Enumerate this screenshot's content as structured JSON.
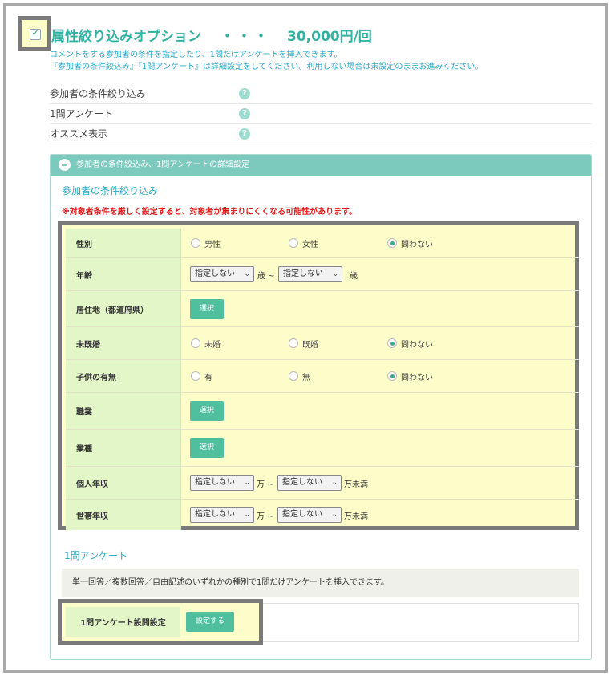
{
  "header": {
    "checkbox_checked": true,
    "title": "属性絞り込みオプション",
    "separator": "・・・",
    "price": "30,000円/回",
    "description_line1": "コメントをする参加者の条件を指定したり、1問だけアンケートを挿入できます。",
    "description_line2": "『参加者の条件絞込み』『1問アンケート』は詳細設定をしてください。利用しない場合は未設定のままお進みください。"
  },
  "options": [
    {
      "label": "参加者の条件絞り込み",
      "icon": "help-icon",
      "glyph": "?"
    },
    {
      "label": "1問アンケート",
      "icon": "help-icon",
      "glyph": "?"
    },
    {
      "label": "オススメ表示",
      "icon": "help-icon",
      "glyph": "?"
    }
  ],
  "panel": {
    "title": "参加者の条件絞込み、1問アンケートの詳細設定"
  },
  "conditions": {
    "section_title": "参加者の条件絞り込み",
    "warning": "※対象者条件を厳しく設定すると、対象者が集まりにくくなる可能性があります。",
    "gender": {
      "label": "性別",
      "options": [
        "男性",
        "女性",
        "問わない"
      ],
      "selected": 2
    },
    "age": {
      "label": "年齢",
      "from": "指定しない",
      "to": "指定しない",
      "unit_mid": "歳 ~",
      "unit_end": "歳"
    },
    "residence": {
      "label": "居住地（都道府県）",
      "button": "選択"
    },
    "marital": {
      "label": "未既婚",
      "options": [
        "未婚",
        "既婚",
        "問わない"
      ],
      "selected": 2
    },
    "children": {
      "label": "子供の有無",
      "options": [
        "有",
        "無",
        "問わない"
      ],
      "selected": 2
    },
    "occupation": {
      "label": "職業",
      "button": "選択"
    },
    "industry": {
      "label": "業種",
      "button": "選択"
    },
    "personal_income": {
      "label": "個人年収",
      "from": "指定しない",
      "to": "指定しない",
      "unit_mid": "万 ~",
      "unit_end": "万未満"
    },
    "household_income": {
      "label": "世帯年収",
      "from": "指定しない",
      "to": "指定しない",
      "unit_mid": "万 ~",
      "unit_end": "万未満"
    }
  },
  "survey": {
    "section_title": "1問アンケート",
    "description": "単一回答／複数回答／自由記述のいずれかの種別で1問だけアンケートを挿入できます。",
    "setting_label": "1問アンケート設問設定",
    "setting_button": "設定する"
  },
  "colors": {
    "accent": "#33b1a0",
    "link_blue": "#2ba8c9",
    "warning": "#e01b1b",
    "button_green": "#4fbf9d",
    "highlight": "#fdfdc9",
    "label_bg": "#e3f6c7"
  }
}
